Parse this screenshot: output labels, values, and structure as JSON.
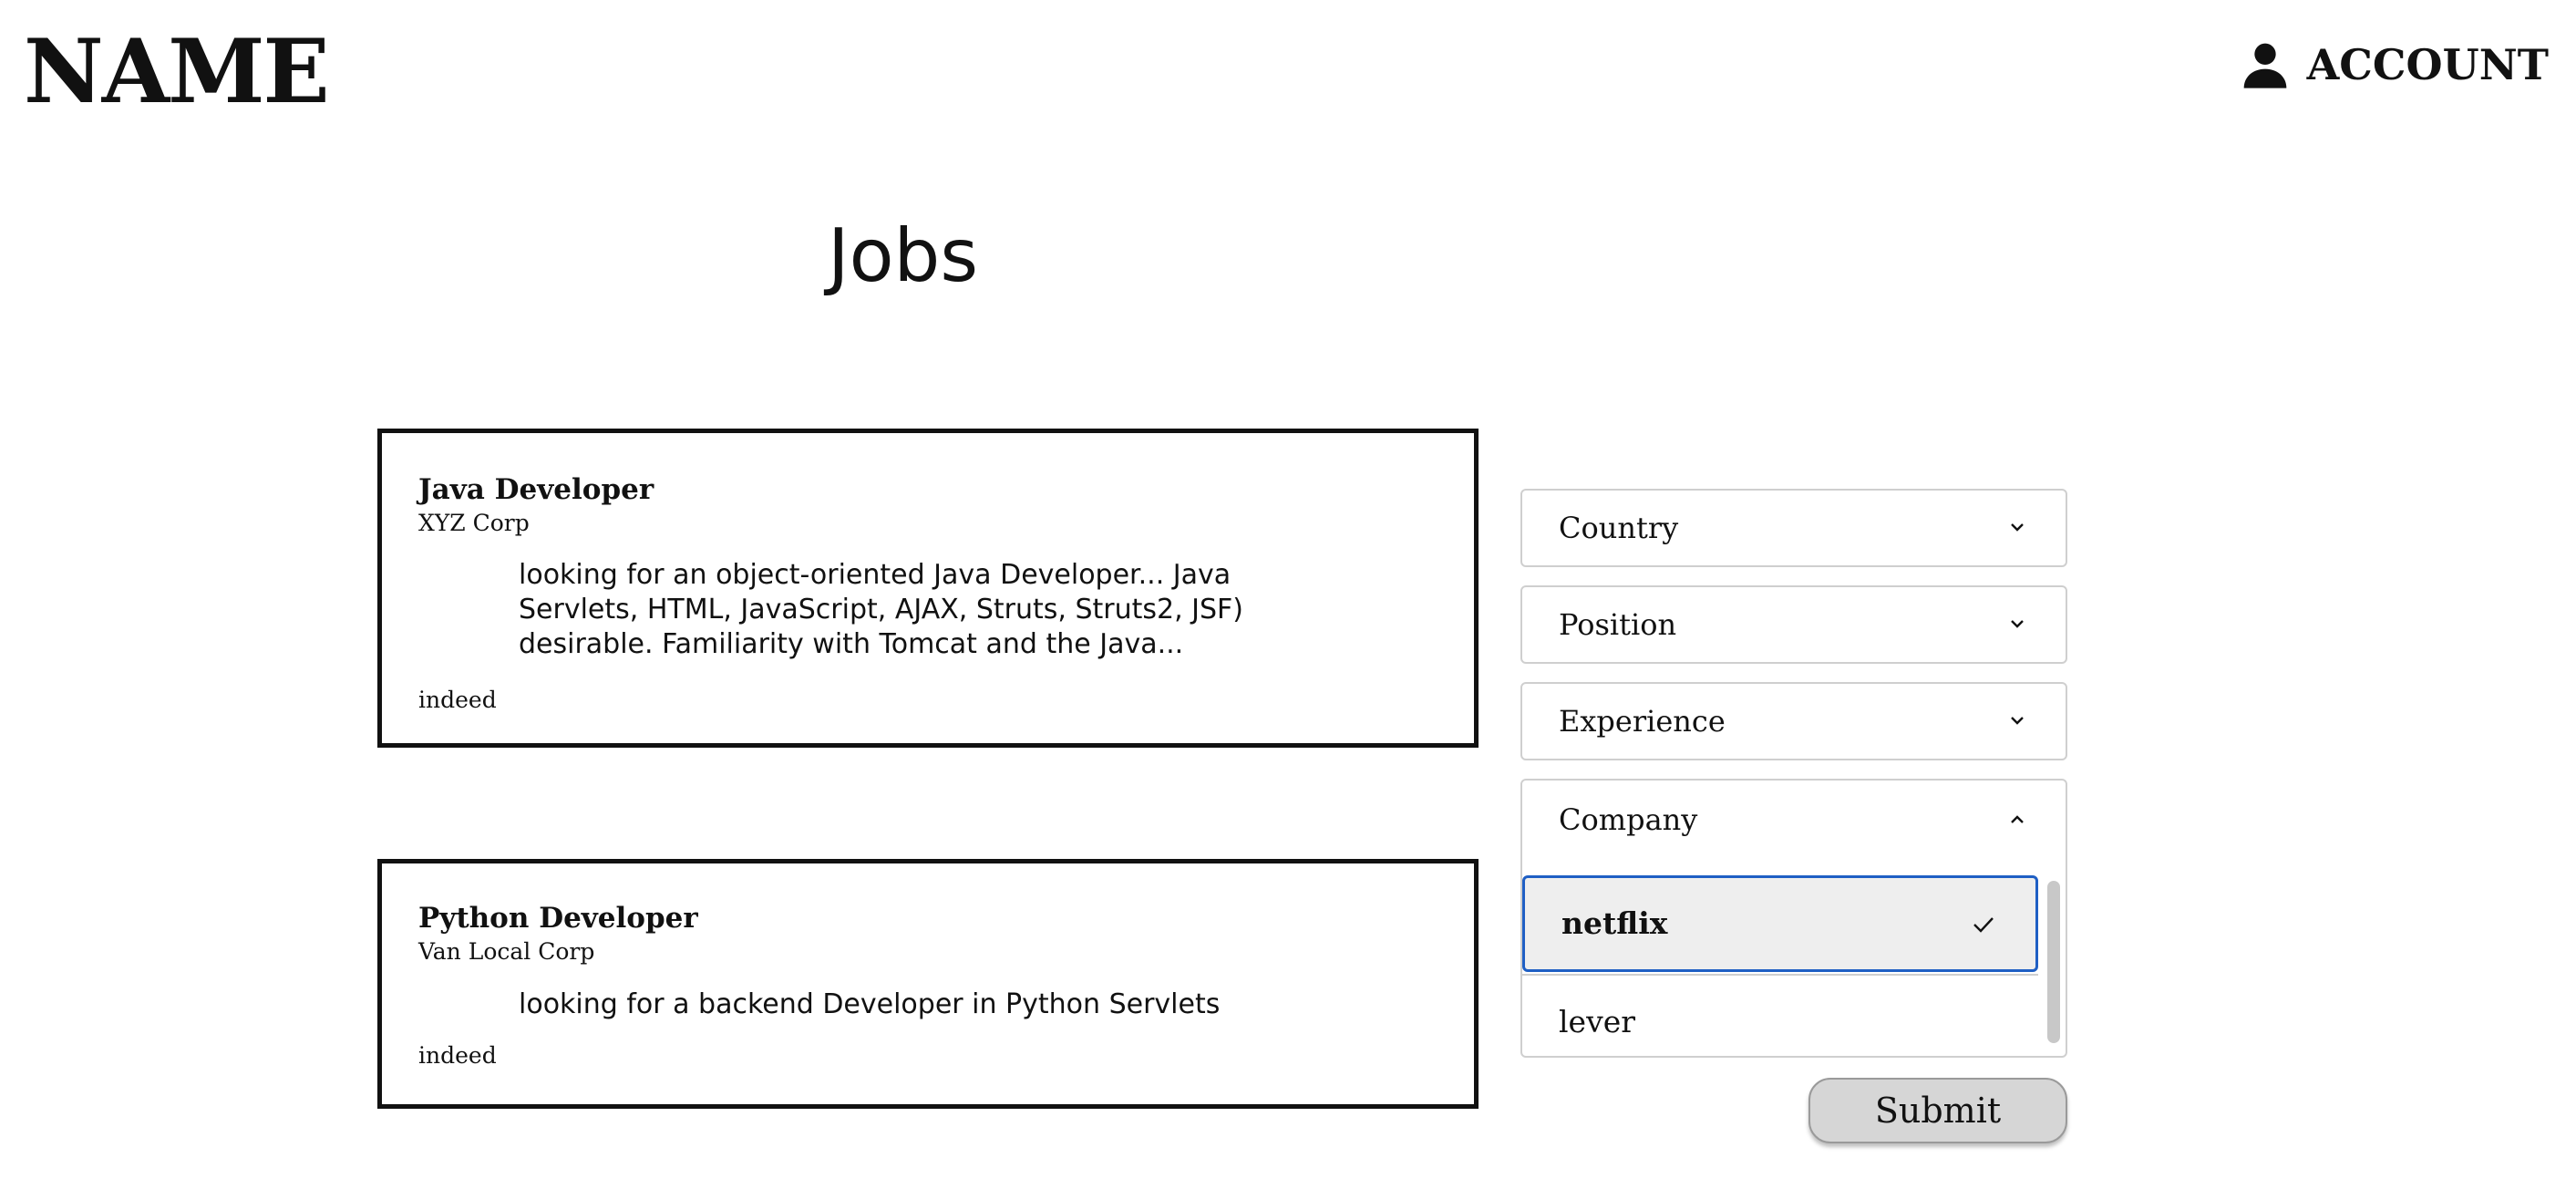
{
  "header": {
    "brand": "NAME",
    "account_label": "ACCOUNT",
    "account_icon": "person-icon"
  },
  "page": {
    "title": "Jobs"
  },
  "jobs": [
    {
      "title": "Java Developer",
      "company": "XYZ Corp",
      "description": "looking for an object-oriented Java Developer... Java Servlets, HTML, JavaScript, AJAX, Struts, Struts2, JSF) desirable. Familiarity with Tomcat and the Java...",
      "source": "indeed"
    },
    {
      "title": "Python Developer",
      "company": "Van Local Corp",
      "description": "looking for a backend Developer in Python Servlets",
      "source": "indeed"
    }
  ],
  "filters": {
    "country": {
      "label": "Country",
      "state": "collapsed"
    },
    "position": {
      "label": "Position",
      "state": "collapsed"
    },
    "experience": {
      "label": "Experience",
      "state": "collapsed"
    },
    "company": {
      "label": "Company",
      "state": "expanded",
      "options": [
        {
          "label": "netflix",
          "selected": true
        },
        {
          "label": "lever",
          "selected": false
        }
      ]
    }
  },
  "actions": {
    "submit_label": "Submit"
  },
  "colors": {
    "text": "#111111",
    "card_border": "#111111",
    "focus_border": "#1f5fc4",
    "selected_bg": "#eeeeee",
    "button_bg": "#d6d6d6"
  }
}
